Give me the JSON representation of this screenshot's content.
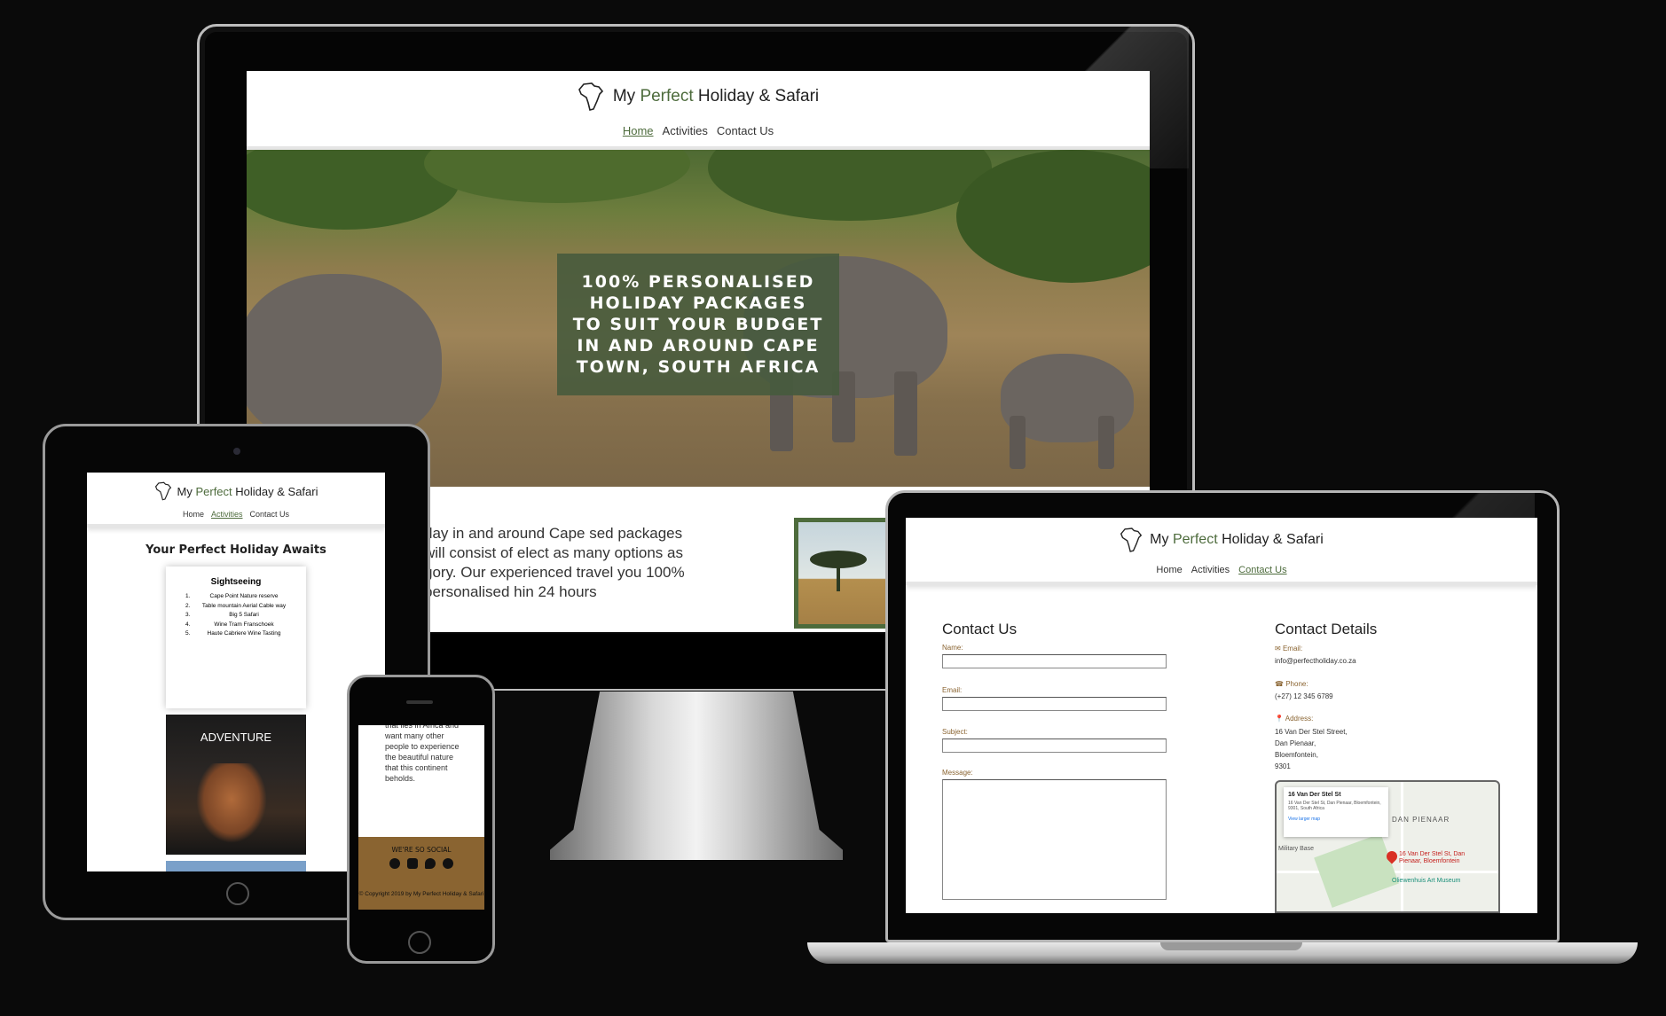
{
  "site": {
    "brand_prefix": "My",
    "brand_accent": "Perfect",
    "brand_suffix": "Holiday & Safari",
    "nav": [
      "Home",
      "Activities",
      "Contact Us"
    ]
  },
  "monitor": {
    "active_nav": "Home",
    "hero_text": "100% PERSONALISED HOLIDAY PACKAGES TO SUIT YOUR BUDGET IN AND AROUND CAPE TOWN, SOUTH AFRICA",
    "body_text": "day in and around Cape sed packages will consist of elect as many options as gory. Our experienced travel you 100% personalised hin 24 hours"
  },
  "tablet": {
    "active_nav": "Activities",
    "section_title": "Your Perfect Holiday Awaits",
    "card1_title": "Sightseeing",
    "card1_items": [
      {
        "n": "1.",
        "t": "Cape Point Nature reserve"
      },
      {
        "n": "2.",
        "t": "Table mountain Aerial Cable way"
      },
      {
        "n": "3.",
        "t": "Big 5 Safari"
      },
      {
        "n": "4.",
        "t": "Wine Tram Franschoek"
      },
      {
        "n": "5.",
        "t": "Haute Cabriere Wine Tasting"
      }
    ],
    "card2_title": "ADVENTURE"
  },
  "phone": {
    "text": "that lies in Africa and want many other people to experience the beautiful nature that this continent beholds.",
    "social_title": "WE'RE SO SOCIAL",
    "social_icons": [
      "facebook-icon",
      "instagram-icon",
      "twitter-icon",
      "pinterest-icon"
    ],
    "copyright": "© Copyright 2019 by My Perfect Holiday & Safari"
  },
  "laptop": {
    "active_nav": "Contact Us",
    "form_title": "Contact Us",
    "form_labels": {
      "name": "Name:",
      "email": "Email:",
      "subject": "Subject:",
      "message": "Message:"
    },
    "details_title": "Contact Details",
    "email_label": "Email:",
    "email_value": "info@perfectholiday.co.za",
    "phone_label": "Phone:",
    "phone_value": "(+27) 12 345 6789",
    "address_label": "Address:",
    "address_lines": [
      "16 Van Der Stel Street,",
      "Dan Pienaar,",
      "Bloemfontein,",
      "9301"
    ],
    "map": {
      "place_title": "16 Van Der Stel St",
      "place_address": "16 Van Der Stel St, Dan Pienaar, Bloemfontein, 9301, South Africa",
      "larger_map": "View larger map",
      "area_label": "DAN PIENAAR",
      "pin_label": "16 Van Der Stel St, Dan Pienaar, Bloemfontein",
      "museum": "Oliewenhuis Art Museum",
      "military": "Military Base"
    }
  },
  "colors": {
    "accent_green": "#4d6b3c",
    "footer_brown": "#8a6431",
    "background": "#0a0a0a"
  }
}
